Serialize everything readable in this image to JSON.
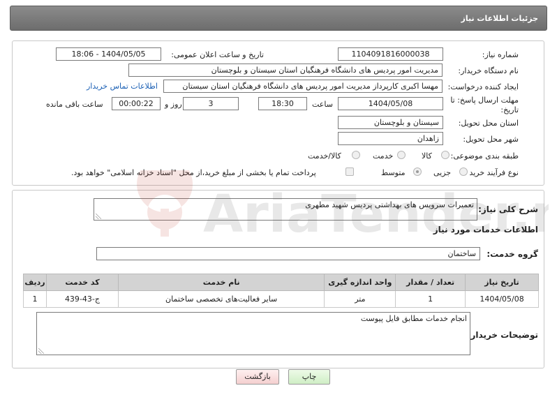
{
  "header": {
    "title": "جزئیات اطلاعات نیاز"
  },
  "form": {
    "need_number_label": "شماره نیاز:",
    "need_number": "1104091816000038",
    "announce_label": "تاریخ و ساعت اعلان عمومی:",
    "announce_value": "1404/05/05 - 18:06",
    "buyer_org_label": "نام دستگاه خریدار:",
    "buyer_org": "مدیریت امور پردیس های دانشگاه فرهنگیان استان سیستان و بلوچستان",
    "creator_label": "ایجاد کننده درخواست:",
    "creator": "مهسا اکبری کارپرداز مدیریت امور پردیس های دانشگاه فرهنگیان استان سیستان",
    "contact_link": "اطلاعات تماس خریدار",
    "deadline_label_1": "مهلت ارسال پاسخ: تا",
    "deadline_label_2": "تاریخ:",
    "deadline_date": "1404/05/08",
    "time_label": "ساعت",
    "deadline_time": "18:30",
    "days_value": "3",
    "days_label": "روز و",
    "remaining_value": "00:00:22",
    "remaining_label": "ساعت باقی مانده",
    "province_label": "استان محل تحویل:",
    "province": "سیستان و بلوچستان",
    "city_label": "شهر محل تحویل:",
    "city": "زاهدان",
    "category_label": "طبقه بندی موضوعی:",
    "category_options": [
      "کالا",
      "خدمت",
      "کالا/خدمت"
    ],
    "process_label": "نوع فرآیند خرید :",
    "process_options": [
      "جزیی",
      "متوسط"
    ],
    "payment_note": "پرداخت تمام یا بخشی از مبلغ خرید،از محل \"اسناد خزانه اسلامی\" خواهد بود."
  },
  "details": {
    "summary_label": "شرح کلی نیاز:",
    "summary": "تعمیرات سرویس های بهداشتی پردیس شهید مطهری",
    "services_heading": "اطلاعات خدمات مورد نیاز",
    "group_label": "گروه خدمت:",
    "group_value": "ساختمان",
    "table": {
      "headers": [
        "ردیف",
        "کد خدمت",
        "نام خدمت",
        "واحد اندازه گیری",
        "تعداد / مقدار",
        "تاریخ نیاز"
      ],
      "rows": [
        [
          "1",
          "ج-43-439",
          "سایر فعالیت‌های تخصصی ساختمان",
          "متر",
          "1",
          "1404/05/08"
        ]
      ]
    },
    "buyer_notes_label": "توضیحات خریدار:",
    "buyer_notes": "انجام خدمات مطابق فایل پیوست"
  },
  "buttons": {
    "print": "چاپ",
    "back": "بازگشت"
  },
  "watermark_text": "AriaTender.net"
}
